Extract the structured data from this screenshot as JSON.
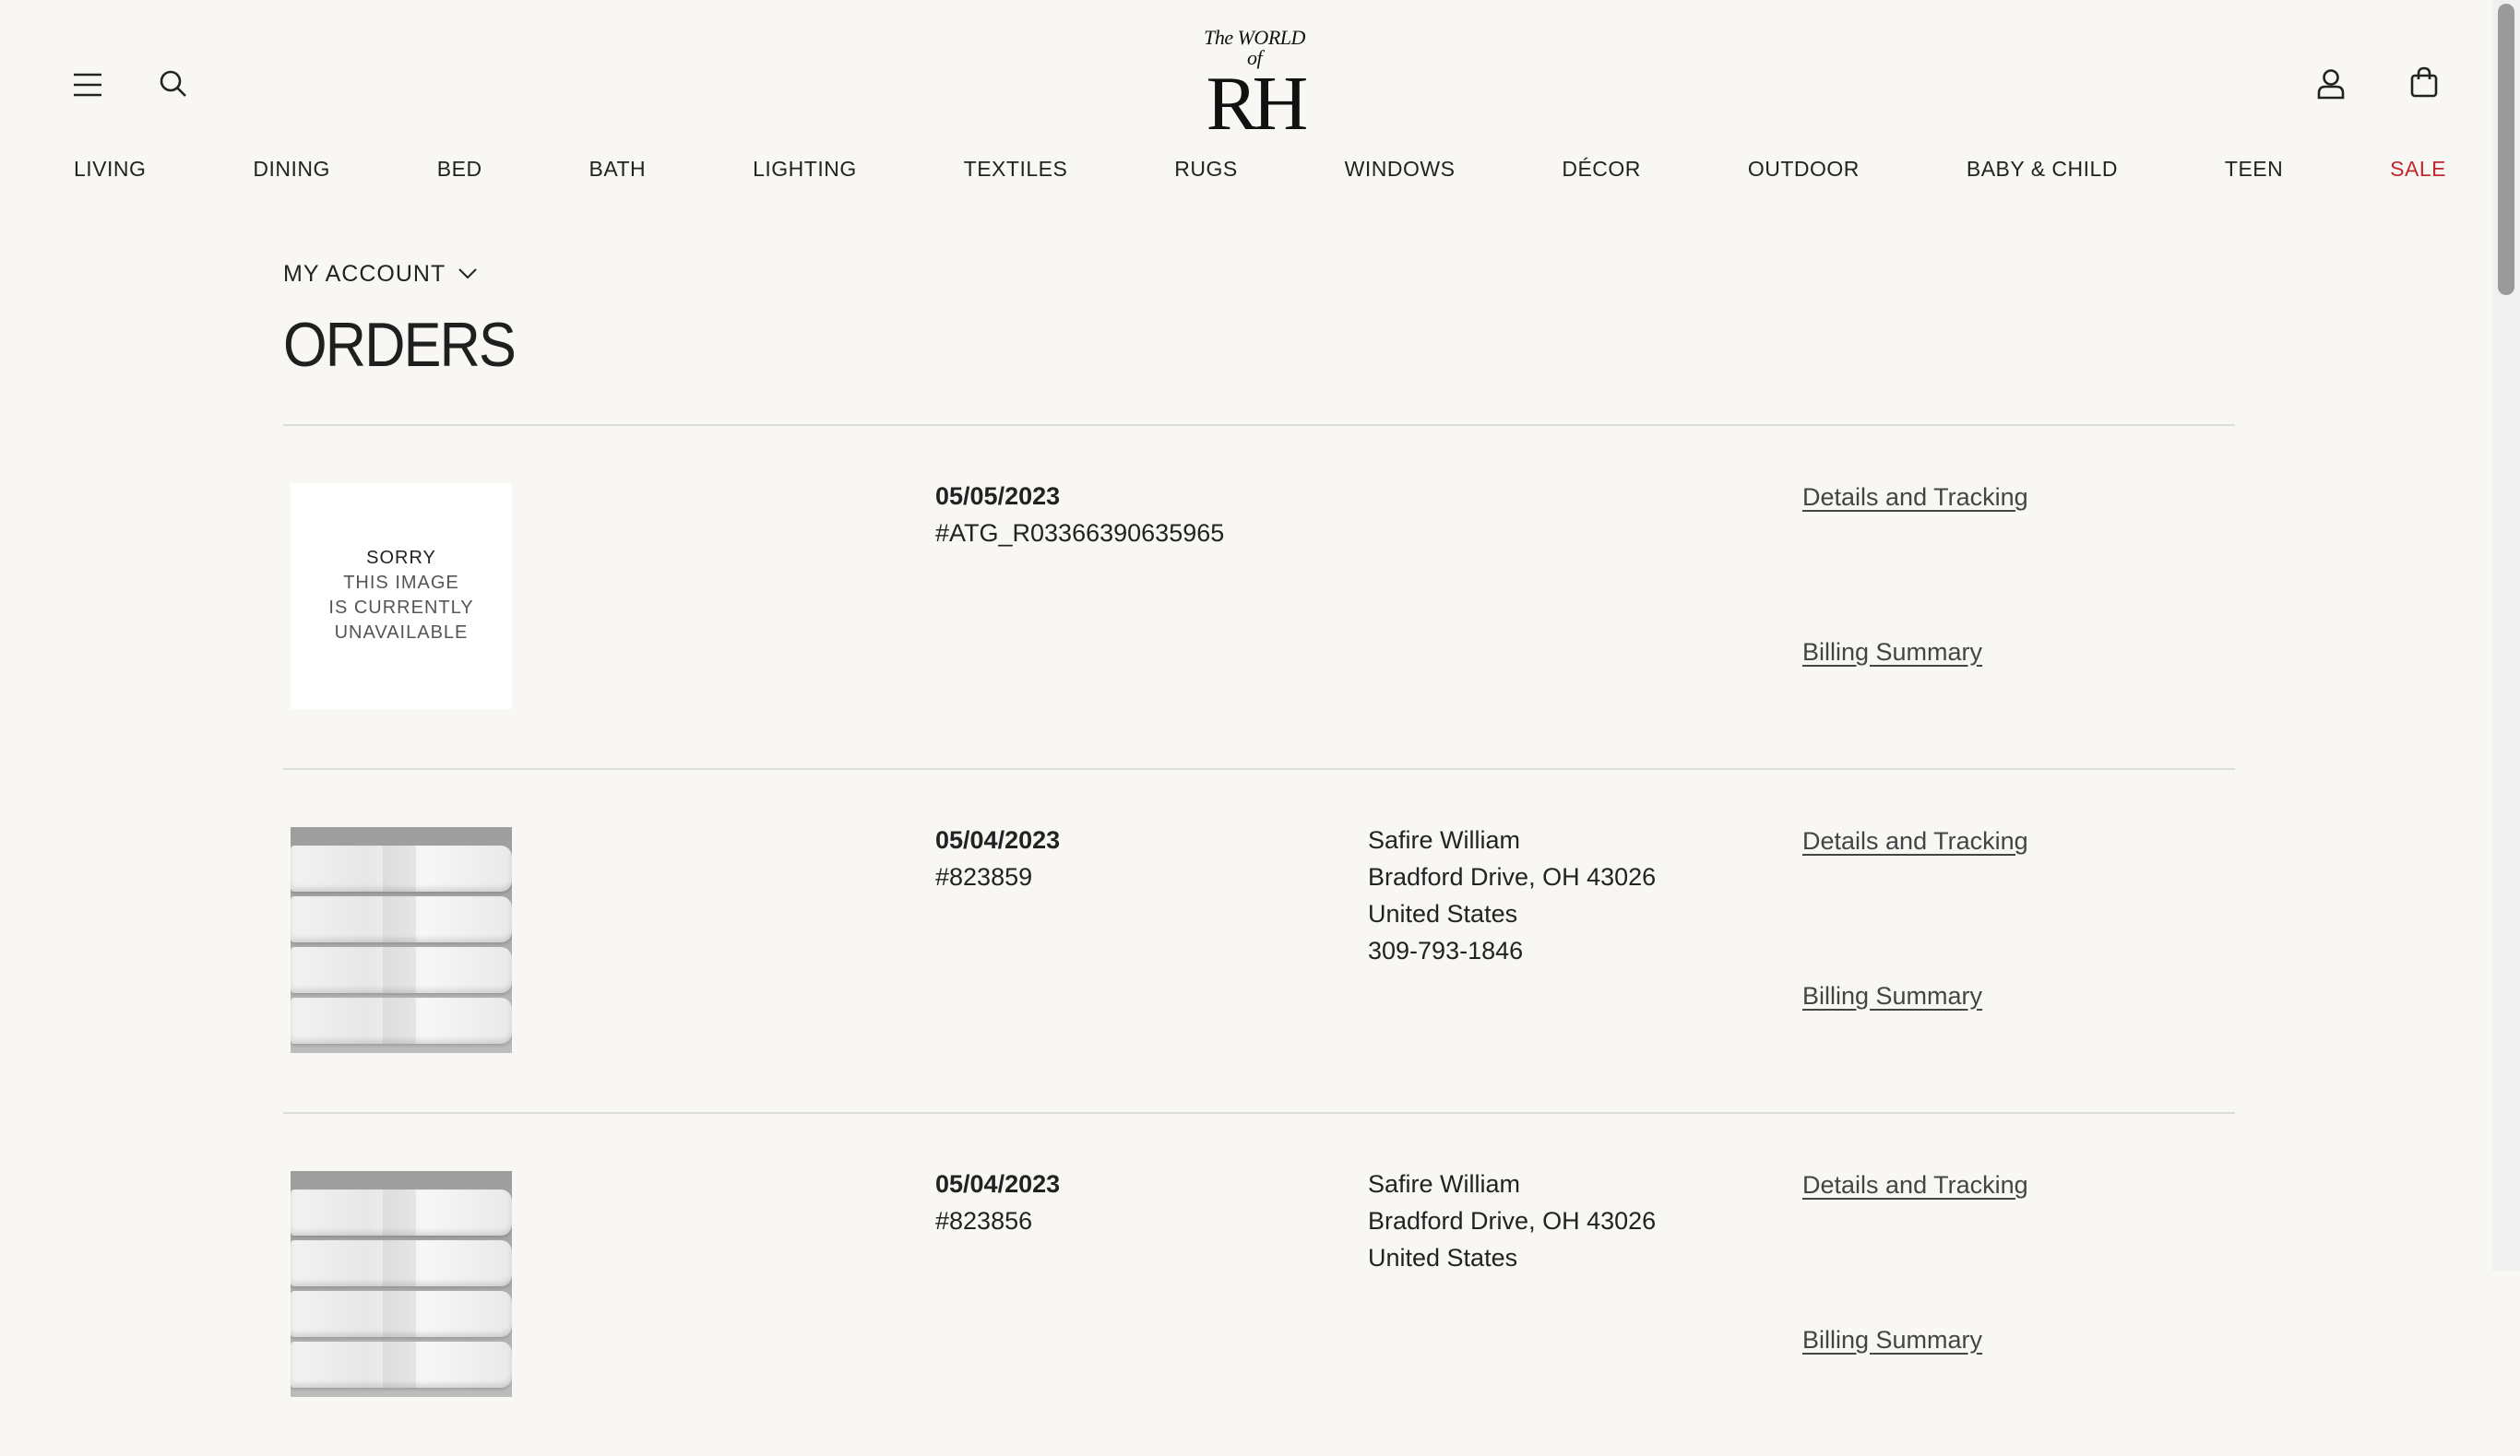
{
  "header": {
    "menu_icon": "menu-icon",
    "search_icon": "search-icon",
    "account_icon": "account-icon",
    "cart_icon": "shopping-bag-icon",
    "logo_small": "The WORLD of",
    "logo_big": "RH"
  },
  "nav": [
    "LIVING",
    "DINING",
    "BED",
    "BATH",
    "LIGHTING",
    "TEXTILES",
    "RUGS",
    "WINDOWS",
    "DÉCOR",
    "OUTDOOR",
    "BABY & CHILD",
    "TEEN",
    "SALE"
  ],
  "colors": {
    "sale": "#c1272d",
    "background": "#f8f7f4"
  },
  "account": {
    "label": "MY ACCOUNT",
    "icon": "chevron-down-icon"
  },
  "page": {
    "title": "ORDERS"
  },
  "placeholder": {
    "line1": "SORRY",
    "line2": "THIS IMAGE",
    "line3": "IS CURRENTLY",
    "line4": "UNAVAILABLE"
  },
  "orders": [
    {
      "date": "05/05/2023",
      "number": "#ATG_R03366390635965",
      "image": "unavailable",
      "address": [],
      "details_link": "Details and Tracking",
      "billing_link": "Billing Summary"
    },
    {
      "date": "05/04/2023",
      "number": "#823859",
      "image": "towels",
      "address": [
        "Safire William",
        "Bradford Drive, OH 43026",
        "United States",
        "309-793-1846"
      ],
      "details_link": "Details and Tracking",
      "billing_link": "Billing Summary"
    },
    {
      "date": "05/04/2023",
      "number": "#823856",
      "image": "towels",
      "address": [
        "Safire William",
        "Bradford Drive, OH 43026",
        "United States"
      ],
      "details_link": "Details and Tracking",
      "billing_link": "Billing Summary"
    }
  ]
}
